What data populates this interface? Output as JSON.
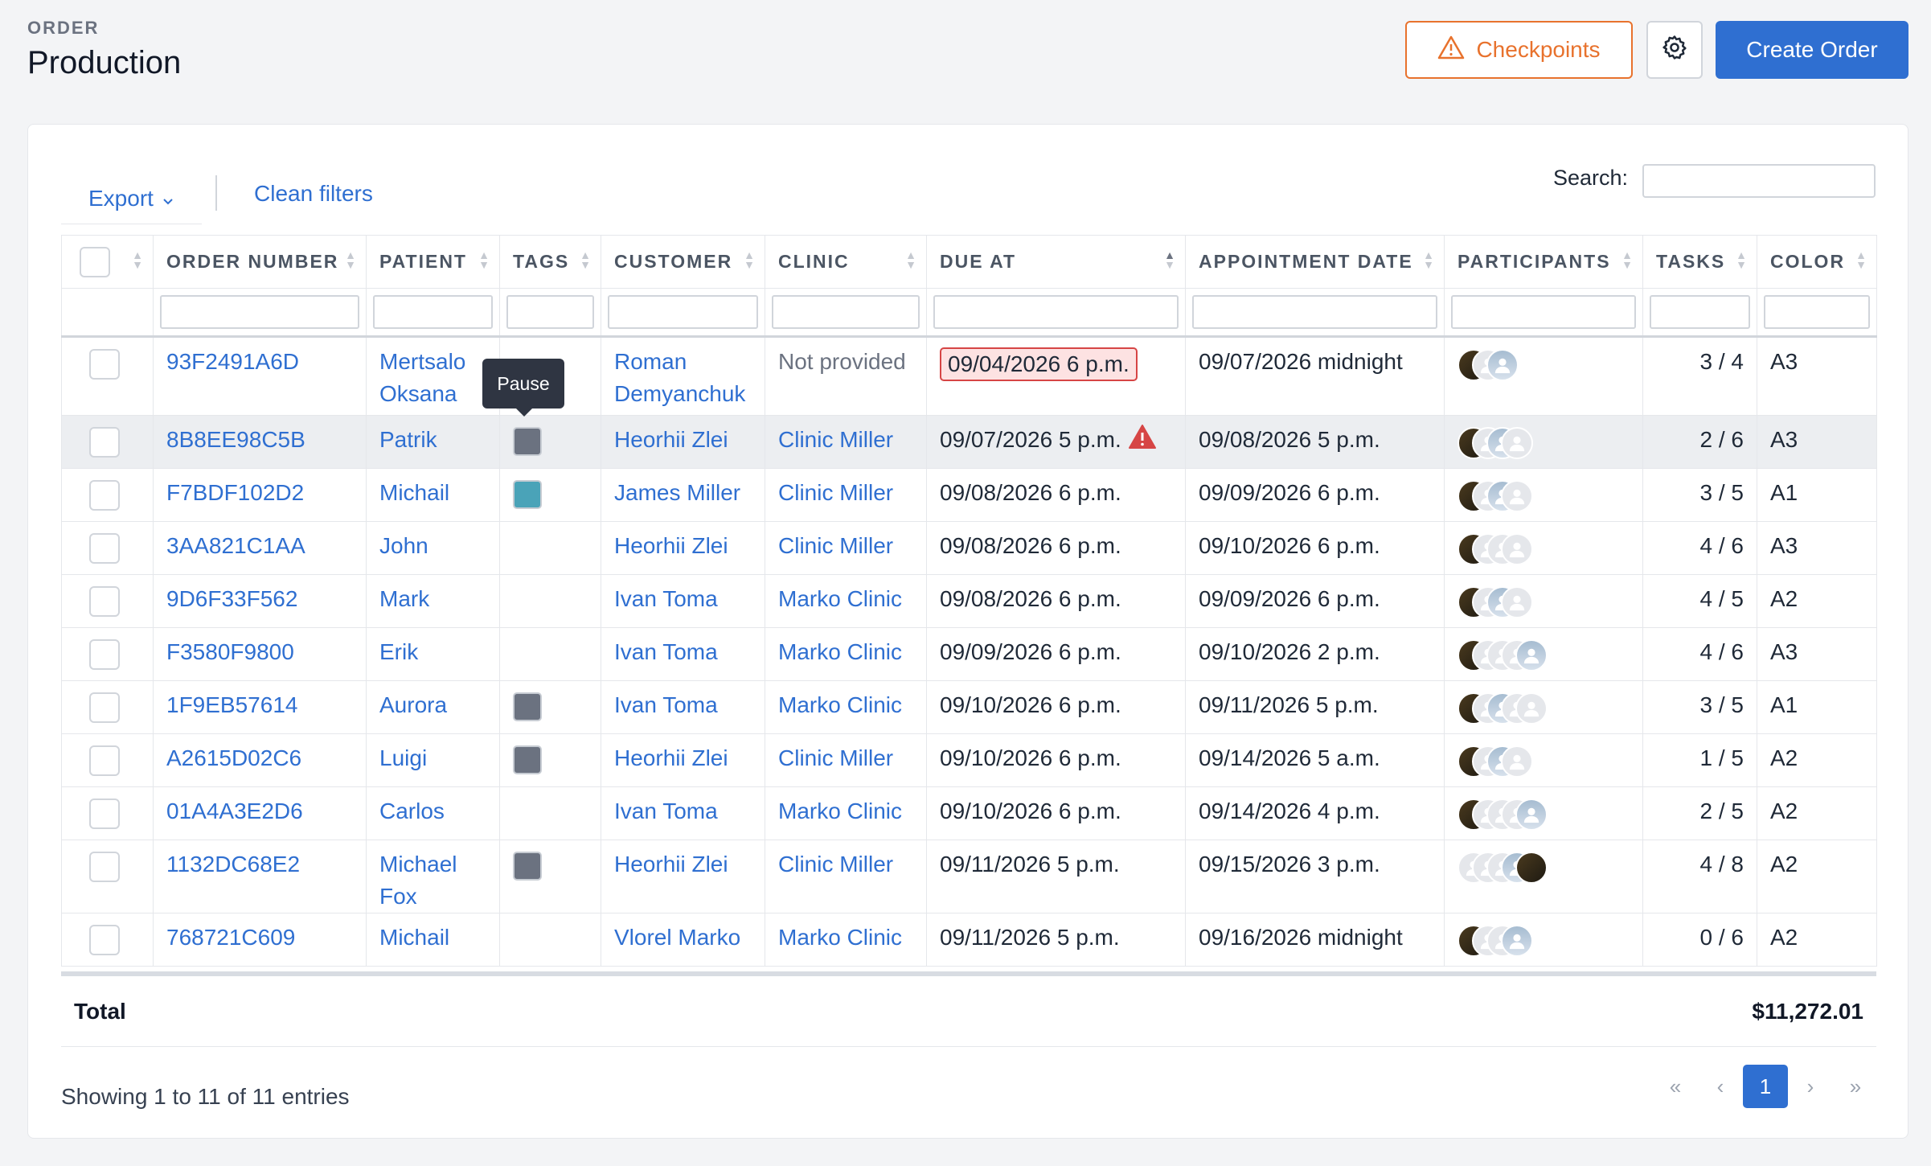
{
  "header": {
    "label": "ORDER",
    "title": "Production"
  },
  "actions": {
    "checkpoints_label": "Checkpoints",
    "create_label": "Create Order",
    "settings_icon": "gear-icon",
    "checkpoints_icon": "warning-triangle-icon"
  },
  "toolbar": {
    "export_label": "Export",
    "clean_label": "Clean filters",
    "search_label": "Search:"
  },
  "columns": [
    "ORDER NUMBER",
    "PATIENT",
    "TAGS",
    "CUSTOMER",
    "CLINIC",
    "DUE AT",
    "APPOINTMENT DATE",
    "PARTICIPANTS",
    "TASKS",
    "COLOR"
  ],
  "tooltip": "Pause",
  "colors": {
    "accent": "#2f6fd1",
    "warning": "#e8722d",
    "danger": "#d64545",
    "tag_grey": "#6b7280",
    "tag_teal": "#4aa3b8"
  },
  "rows": [
    {
      "order": "93F2491A6D",
      "patient": "Mertsalo Oksana",
      "tag": "",
      "customer": "Roman Demyanchuk",
      "clinic": "Not provided",
      "due": "09/04/2026 6 p.m.",
      "due_overdue": true,
      "due_warning": false,
      "appt": "09/07/2026 midnight",
      "participants": [
        "dark",
        "grey",
        "photo"
      ],
      "tasks": "3 / 4",
      "color": "A3"
    },
    {
      "order": "8B8EE98C5B",
      "patient": "Patrik",
      "tag": "grey",
      "customer": "Heorhii Zlei",
      "clinic": "Clinic Miller",
      "due": "09/07/2026 5 p.m.",
      "due_overdue": false,
      "due_warning": true,
      "appt": "09/08/2026 5 p.m.",
      "participants": [
        "dark",
        "grey",
        "photo",
        "grey"
      ],
      "tasks": "2 / 6",
      "color": "A3"
    },
    {
      "order": "F7BDF102D2",
      "patient": "Michail",
      "tag": "teal",
      "customer": "James Miller",
      "clinic": "Clinic Miller",
      "due": "09/08/2026 6 p.m.",
      "due_overdue": false,
      "due_warning": false,
      "appt": "09/09/2026 6 p.m.",
      "participants": [
        "dark",
        "grey",
        "photo",
        "grey"
      ],
      "tasks": "3 / 5",
      "color": "A1"
    },
    {
      "order": "3AA821C1AA",
      "patient": "John",
      "tag": "",
      "customer": "Heorhii Zlei",
      "clinic": "Clinic Miller",
      "due": "09/08/2026 6 p.m.",
      "due_overdue": false,
      "due_warning": false,
      "appt": "09/10/2026 6 p.m.",
      "participants": [
        "dark",
        "grey",
        "grey",
        "grey"
      ],
      "tasks": "4 / 6",
      "color": "A3"
    },
    {
      "order": "9D6F33F562",
      "patient": "Mark",
      "tag": "",
      "customer": "Ivan Toma",
      "clinic": "Marko Clinic",
      "due": "09/08/2026 6 p.m.",
      "due_overdue": false,
      "due_warning": false,
      "appt": "09/09/2026 6 p.m.",
      "participants": [
        "dark",
        "grey",
        "photo",
        "grey"
      ],
      "tasks": "4 / 5",
      "color": "A2"
    },
    {
      "order": "F3580F9800",
      "patient": "Erik",
      "tag": "",
      "customer": "Ivan Toma",
      "clinic": "Marko Clinic",
      "due": "09/09/2026 6 p.m.",
      "due_overdue": false,
      "due_warning": false,
      "appt": "09/10/2026 2 p.m.",
      "participants": [
        "dark",
        "grey",
        "grey",
        "grey",
        "photo"
      ],
      "tasks": "4 / 6",
      "color": "A3"
    },
    {
      "order": "1F9EB57614",
      "patient": "Aurora",
      "tag": "grey",
      "customer": "Ivan Toma",
      "clinic": "Marko Clinic",
      "due": "09/10/2026 6 p.m.",
      "due_overdue": false,
      "due_warning": false,
      "appt": "09/11/2026 5 p.m.",
      "participants": [
        "dark",
        "grey",
        "photo",
        "grey",
        "grey"
      ],
      "tasks": "3 / 5",
      "color": "A1"
    },
    {
      "order": "A2615D02C6",
      "patient": "Luigi",
      "tag": "grey",
      "customer": "Heorhii Zlei",
      "clinic": "Clinic Miller",
      "due": "09/10/2026 6 p.m.",
      "due_overdue": false,
      "due_warning": false,
      "appt": "09/14/2026 5 a.m.",
      "participants": [
        "dark",
        "grey",
        "photo",
        "grey"
      ],
      "tasks": "1 / 5",
      "color": "A2"
    },
    {
      "order": "01A4A3E2D6",
      "patient": "Carlos",
      "tag": "",
      "customer": "Ivan Toma",
      "clinic": "Marko Clinic",
      "due": "09/10/2026 6 p.m.",
      "due_overdue": false,
      "due_warning": false,
      "appt": "09/14/2026 4 p.m.",
      "participants": [
        "dark",
        "grey",
        "grey",
        "grey",
        "photo"
      ],
      "tasks": "2 / 5",
      "color": "A2"
    },
    {
      "order": "1132DC68E2",
      "patient": "Michael Fox",
      "tag": "grey",
      "customer": "Heorhii Zlei",
      "clinic": "Clinic Miller",
      "due": "09/11/2026 5 p.m.",
      "due_overdue": false,
      "due_warning": false,
      "appt": "09/15/2026 3 p.m.",
      "participants": [
        "grey",
        "grey",
        "grey",
        "photo",
        "dark"
      ],
      "tasks": "4 / 8",
      "color": "A2"
    },
    {
      "order": "768721C609",
      "patient": "Michail",
      "tag": "",
      "customer": "Vlorel Marko",
      "clinic": "Marko Clinic",
      "due": "09/11/2026 5 p.m.",
      "due_overdue": false,
      "due_warning": false,
      "appt": "09/16/2026 midnight",
      "participants": [
        "dark",
        "grey",
        "grey",
        "photo"
      ],
      "tasks": "0 / 6",
      "color": "A2"
    }
  ],
  "total": {
    "label": "Total",
    "value": "$11,272.01"
  },
  "footer": {
    "showing": "Showing 1 to 11 of 11 entries",
    "current_page": "1"
  }
}
